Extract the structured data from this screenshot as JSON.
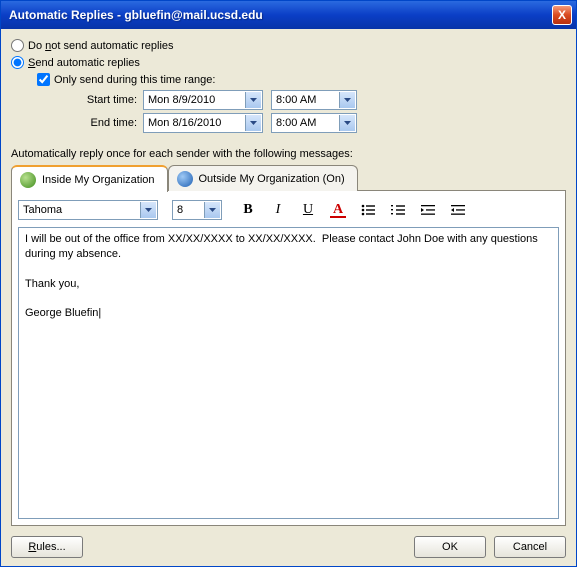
{
  "window": {
    "title": "Automatic Replies - gbluefin@mail.ucsd.edu",
    "close_glyph": "X"
  },
  "radios": {
    "no_send_prefix": "Do ",
    "no_send_key": "n",
    "no_send_suffix": "ot send automatic replies",
    "send_key": "S",
    "send_suffix": "end automatic replies"
  },
  "range": {
    "only_label": "Only send during this time range:",
    "start_label": "Start time:",
    "end_label": "End time:",
    "start_date": "Mon 8/9/2010",
    "end_date": "Mon 8/16/2010",
    "start_time": "8:00 AM",
    "end_time": "8:00 AM"
  },
  "caption": "Automatically reply once for each sender with the following messages:",
  "tabs": {
    "inside": "Inside My Organization",
    "outside": "Outside My Organization (On)"
  },
  "toolbar": {
    "font": "Tahoma",
    "size": "8"
  },
  "message": {
    "body": "I will be out of the office from XX/XX/XXXX to XX/XX/XXXX.  Please contact John Doe with any questions during my absence.",
    "thanks": "Thank you,",
    "signature": "George Bluefin"
  },
  "footer": {
    "rules_key": "R",
    "rules_suffix": "ules...",
    "ok": "OK",
    "cancel": "Cancel"
  }
}
